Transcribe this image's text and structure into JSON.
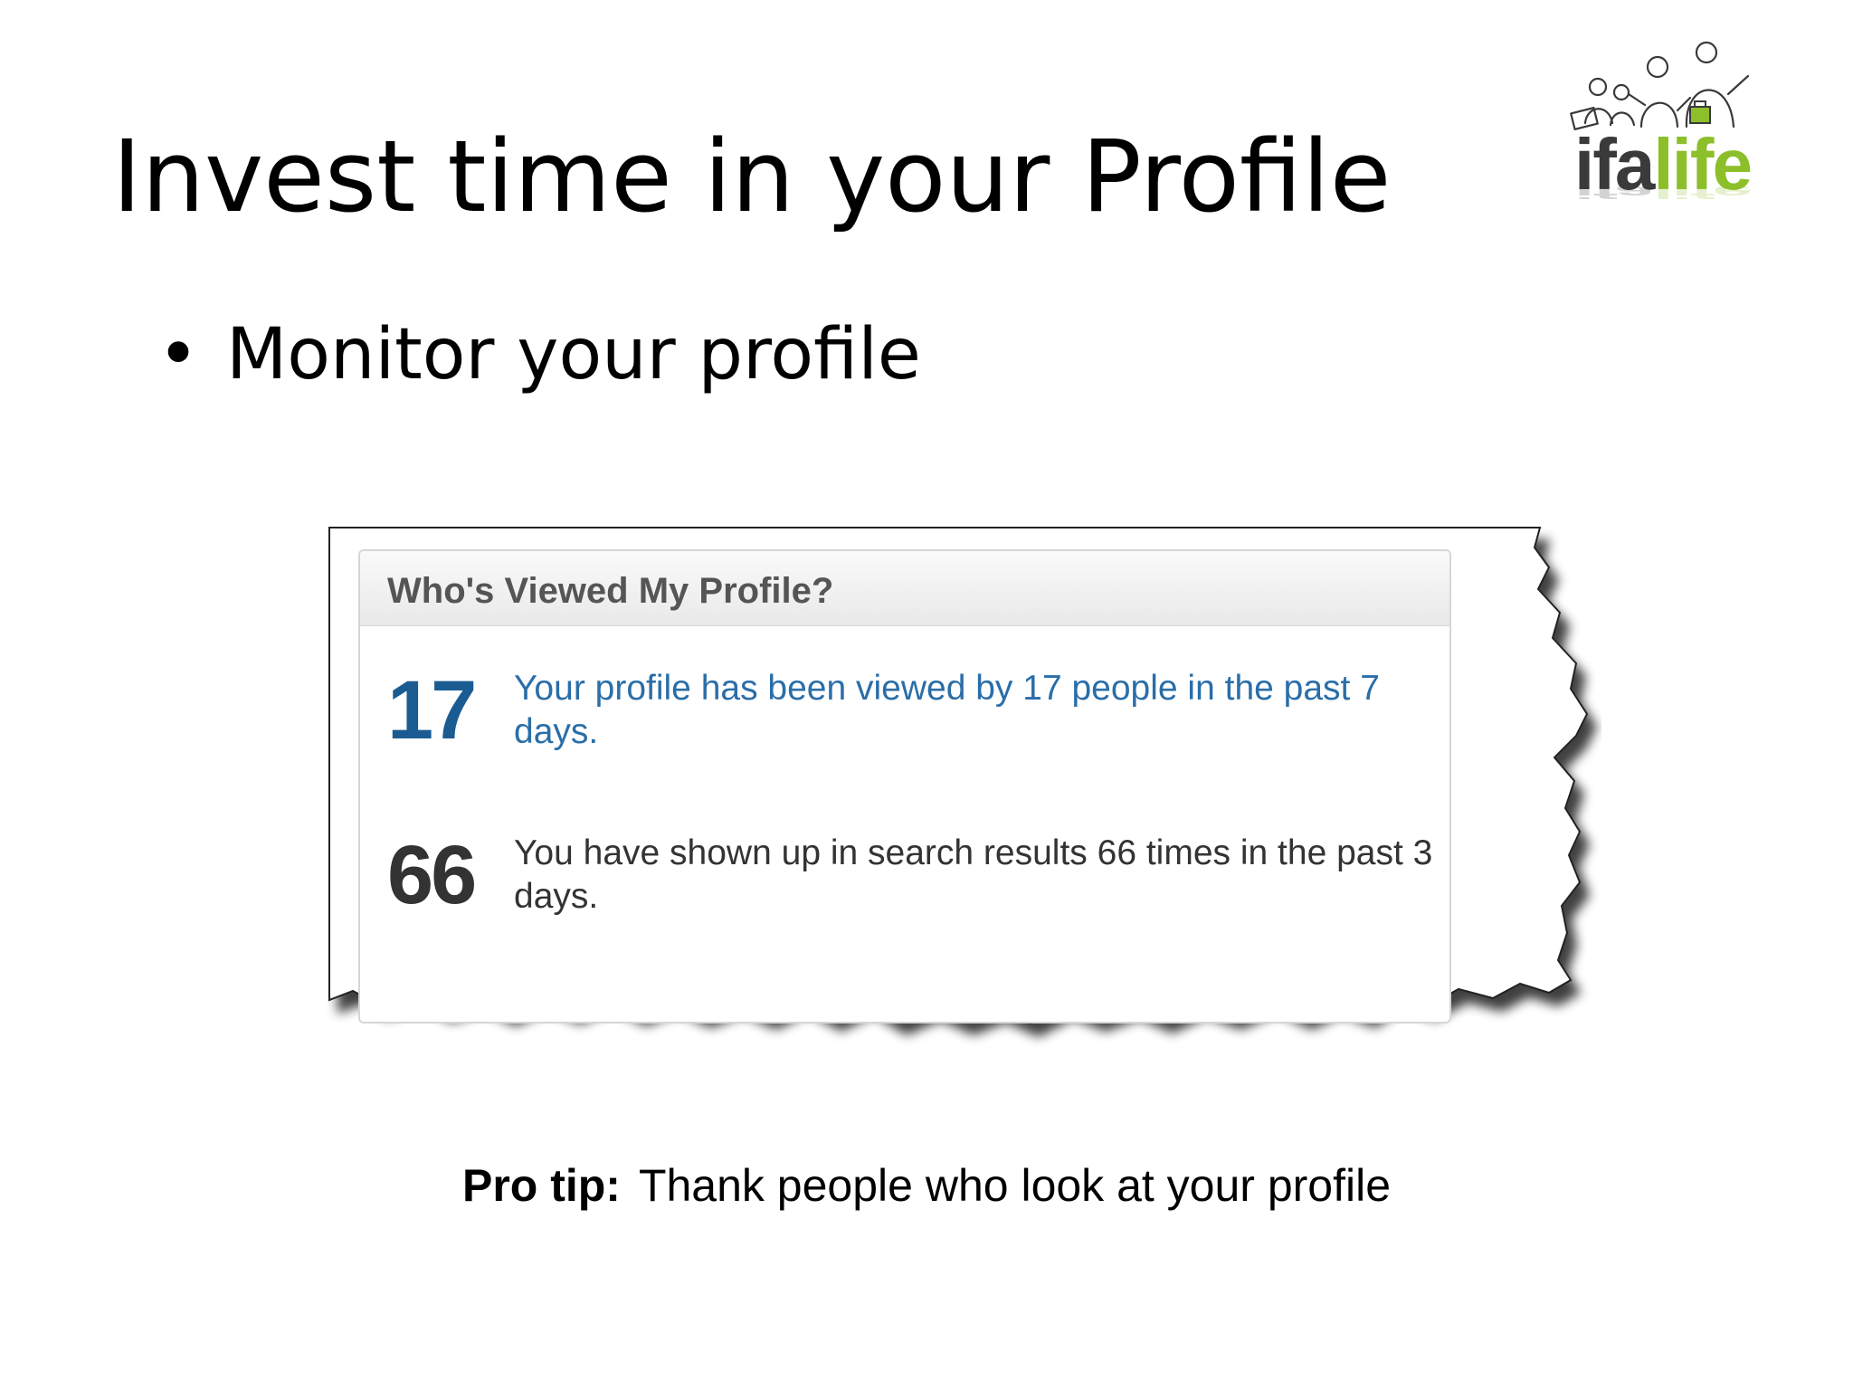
{
  "slide": {
    "title": "Invest time in your Profile",
    "bullet_marker": "•",
    "bullet_text": "Monitor your profile"
  },
  "logo": {
    "text_dark": "ifa",
    "text_green": "life",
    "colors": {
      "dark": "#3a3a3a",
      "green": "#8cbf2a"
    }
  },
  "widget": {
    "title": "Who's Viewed My Profile?",
    "stats": [
      {
        "number": "17",
        "text": "Your profile has been viewed by 17 people in the past 7 days.",
        "color": "#1a5c92"
      },
      {
        "number": "66",
        "text": "You have shown up in search results 66 times in the past 3 days.",
        "color": "#333333"
      }
    ]
  },
  "tip": {
    "label": "Pro tip:",
    "text": "Thank people who look at your profile"
  }
}
